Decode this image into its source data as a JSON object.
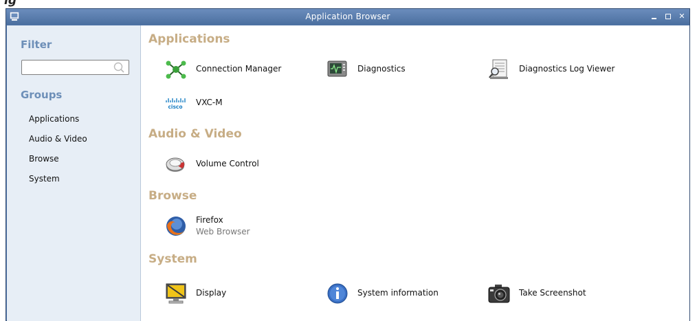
{
  "top_fragment": "ig",
  "window": {
    "title": "Application Browser",
    "controls": [
      "minimize",
      "maximize",
      "close"
    ]
  },
  "sidebar": {
    "filter_heading": "Filter",
    "search": {
      "value": "",
      "placeholder": ""
    },
    "groups_heading": "Groups",
    "groups": [
      {
        "label": "Applications"
      },
      {
        "label": "Audio & Video"
      },
      {
        "label": "Browse"
      },
      {
        "label": "System"
      }
    ]
  },
  "sections": [
    {
      "title": "Applications",
      "apps": [
        {
          "label": "Connection Manager",
          "icon": "network-icon"
        },
        {
          "label": "Diagnostics",
          "icon": "monitor-icon"
        },
        {
          "label": "Diagnostics Log Viewer",
          "icon": "log-viewer-icon"
        },
        {
          "label": "VXC-M",
          "icon": "cisco-icon"
        }
      ]
    },
    {
      "title": "Audio & Video",
      "apps": [
        {
          "label": "Volume Control",
          "icon": "volume-icon"
        }
      ]
    },
    {
      "title": "Browse",
      "apps": [
        {
          "label": "Firefox",
          "subtitle": "Web Browser",
          "icon": "firefox-icon"
        }
      ]
    },
    {
      "title": "System",
      "apps": [
        {
          "label": "Display",
          "icon": "display-icon"
        },
        {
          "label": "System information",
          "icon": "info-icon"
        },
        {
          "label": "Take Screenshot",
          "icon": "camera-icon"
        }
      ]
    }
  ],
  "colors": {
    "titlebar": "#5a7eb0",
    "sidebar_bg": "#e7eef6",
    "section_title": "#c7ad85",
    "sidebar_heading": "#6d8fb8"
  }
}
